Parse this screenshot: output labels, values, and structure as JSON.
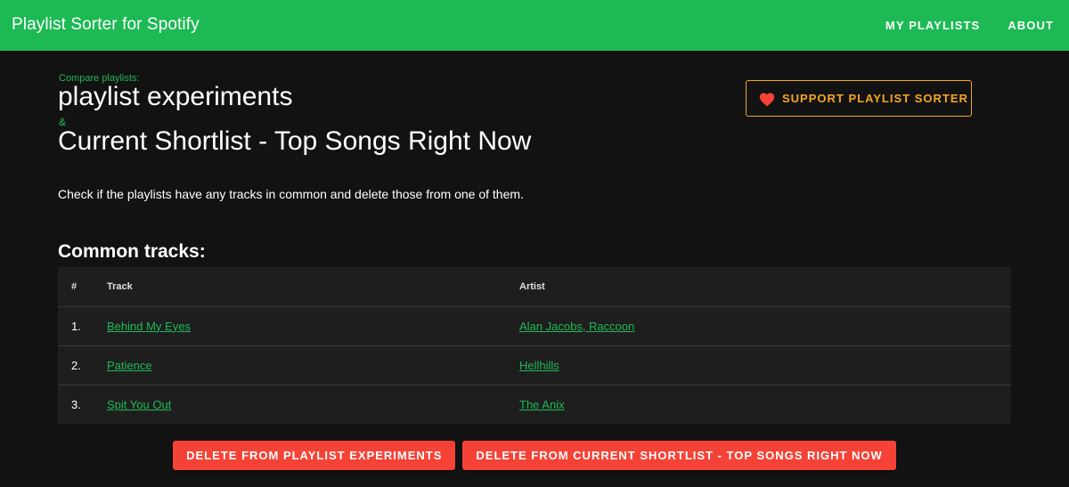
{
  "app": {
    "title": "Playlist Sorter for Spotify"
  },
  "nav": {
    "items": [
      {
        "label": "MY PLAYLISTS"
      },
      {
        "label": "ABOUT"
      }
    ]
  },
  "header": {
    "compare_label": "Compare playlists:",
    "playlist_1": "playlist experiments",
    "ampersand": "&",
    "playlist_2": "Current Shortlist - Top Songs Right Now"
  },
  "support": {
    "label": "SUPPORT PLAYLIST SORTER",
    "icon": "heart-icon",
    "color": "#f5a623",
    "icon_color": "#f44336"
  },
  "description": "Check if the playlists have any tracks in common and delete those from one of them.",
  "common": {
    "heading": "Common tracks:",
    "columns": {
      "num": "#",
      "track": "Track",
      "artist": "Artist"
    },
    "rows": [
      {
        "num": "1.",
        "track": "Behind My Eyes",
        "artist": "Alan Jacobs, Raccoon"
      },
      {
        "num": "2.",
        "track": "Patience",
        "artist": "Hellhills"
      },
      {
        "num": "3.",
        "track": "Spit You Out",
        "artist": "The Anix"
      }
    ]
  },
  "actions": {
    "delete_from_1": "DELETE FROM PLAYLIST EXPERIMENTS",
    "delete_from_2": "DELETE FROM CURRENT SHORTLIST - TOP SONGS RIGHT NOW"
  },
  "colors": {
    "brand": "#1db954",
    "background": "#121212",
    "table_bg": "#1e1e1e",
    "danger": "#f44336"
  }
}
